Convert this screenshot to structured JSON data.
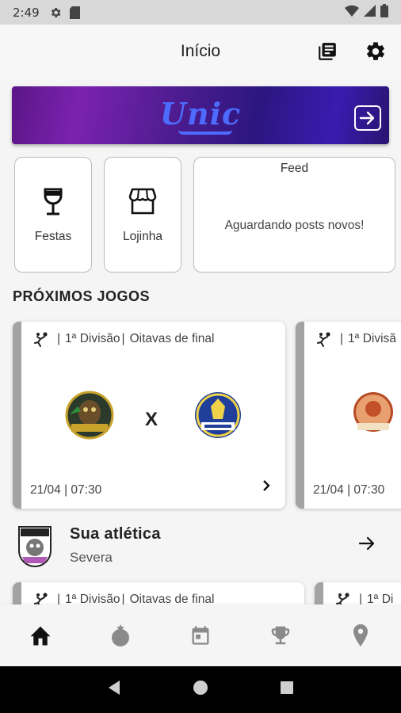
{
  "status_bar": {
    "time": "2:49"
  },
  "app_bar": {
    "title": "Início"
  },
  "banner": {
    "logo_text": "Unic"
  },
  "tiles": {
    "festas_label": "Festas",
    "lojinha_label": "Lojinha",
    "feed_title": "Feed",
    "feed_message": "Aguardando posts novos!"
  },
  "section_title": "PRÓXIMOS JOGOS",
  "games": [
    {
      "division": "1ª Divisão",
      "phase": "Oitavas de final",
      "vs": "X",
      "datetime": "21/04 | 07:30"
    },
    {
      "division": "1ª Divisã",
      "datetime": "21/04 | 07:30"
    },
    {
      "division": "1ª Divisão",
      "phase": "Oitavas de final"
    },
    {
      "division": "1ª Di"
    }
  ],
  "athletic": {
    "title": "Sua atlética",
    "name": "Severa"
  },
  "colors": {
    "banner_purple": "#5b1686",
    "banner_blue": "#4e6bff",
    "stripe": "#a3a3a3"
  }
}
